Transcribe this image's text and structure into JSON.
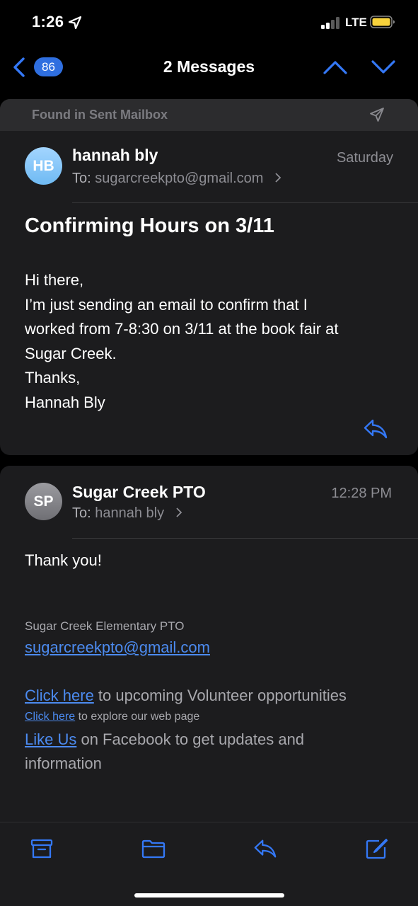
{
  "status_bar": {
    "time": "1:26",
    "network": "LTE",
    "icons": [
      "location-arrow-icon",
      "signal-icon",
      "battery-icon"
    ],
    "battery_color": "#f7d23c"
  },
  "nav": {
    "back_count": "86",
    "title": "2 Messages",
    "icons": [
      "chevron-left-icon",
      "chevron-up-icon",
      "chevron-down-icon"
    ],
    "accent": "#3478f6"
  },
  "messages": [
    {
      "found_in": "Found in Sent Mailbox",
      "avatar_initials": "HB",
      "sender": "hannah bly",
      "to_label": "To:",
      "to": "sugarcreekpto@gmail.com",
      "date": "Saturday",
      "subject": "Confirming Hours on 3/11",
      "body": [
        "Hi there,",
        "I’m just sending an email to confirm that I",
        "worked from 7-8:30 on 3/11 at the book fair at",
        "Sugar Creek.",
        "Thanks,",
        "Hannah Bly"
      ]
    },
    {
      "avatar_initials": "SP",
      "sender": "Sugar Creek PTO",
      "to_label": "To:",
      "to": "hannah bly",
      "date": "12:28 PM",
      "body": "Thank you!",
      "signature": {
        "org": "Sugar Creek Elementary PTO",
        "email": "sugarcreekpto@gmail.com",
        "line1_link": "Click here",
        "line1_text": " to upcoming Volunteer opportunities",
        "line2_link": "Click here",
        "line2_text": " to explore our web page",
        "line3_link": "Like Us",
        "line3_text": " on Facebook to get updates and",
        "line4_text": "information"
      }
    }
  ],
  "toolbar": {
    "icons": [
      "archive-icon",
      "folder-icon",
      "reply-icon",
      "compose-icon"
    ]
  }
}
